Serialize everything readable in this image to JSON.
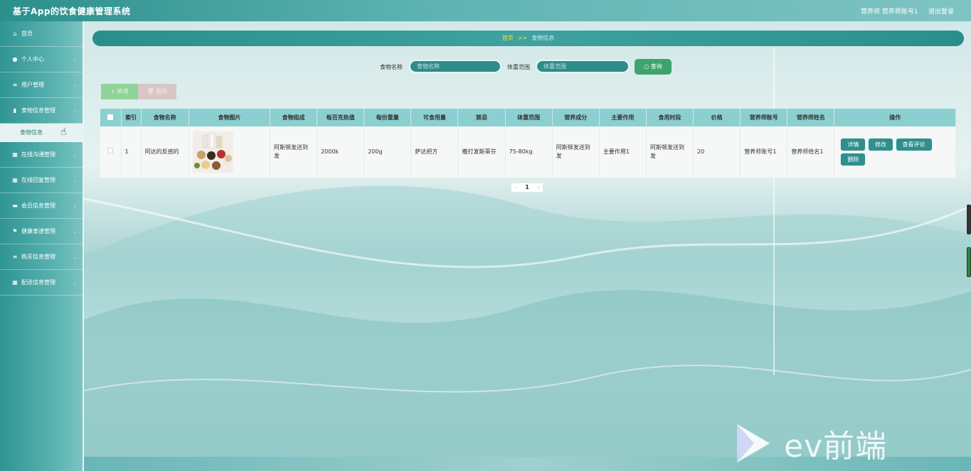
{
  "header": {
    "app_title": "基于App的饮食健康管理系统",
    "user_info": "营养师 营养师账号1",
    "logout": "退出登录"
  },
  "sidebar": {
    "items": [
      {
        "icon": "home-icon",
        "label": "首页"
      },
      {
        "icon": "user-icon",
        "label": "个人中心"
      },
      {
        "icon": "list-icon",
        "label": "用户管理"
      },
      {
        "icon": "book-icon",
        "label": "食物信息管理"
      },
      {
        "icon": "grid-icon",
        "label": "在线沟通管理"
      },
      {
        "icon": "grid-icon",
        "label": "在线回复管理"
      },
      {
        "icon": "card-icon",
        "label": "会员信息管理"
      },
      {
        "icon": "flag-icon",
        "label": "健康食谱管理"
      },
      {
        "icon": "list-icon",
        "label": "购买信息管理"
      },
      {
        "icon": "grid-icon",
        "label": "配送信息管理"
      }
    ],
    "active_sub": "食物信息"
  },
  "breadcrumb": {
    "home": "首页",
    "separator": ">>",
    "current": "食物信息"
  },
  "search": {
    "food_name_label": "食物名称",
    "food_name_placeholder": "食物名称",
    "weight_label": "体重范围",
    "weight_placeholder": "体重范围",
    "query_button": "查询"
  },
  "actions": {
    "add": "新增",
    "delete": "删除"
  },
  "table": {
    "columns": [
      "索引",
      "食物名称",
      "食物图片",
      "食物组成",
      "每百克热值",
      "每份重量",
      "可食用量",
      "禁忌",
      "体重范围",
      "营养成分",
      "主要作用",
      "食用时段",
      "价格",
      "营养师账号",
      "营养师姓名",
      "操作"
    ],
    "rows": [
      {
        "index": "1",
        "food_name": "阿达的反感的",
        "composition": "阿斯顿发送到发",
        "calories": "2000k",
        "portion_weight": "200g",
        "edible_amount": "萨达把方",
        "taboo": "撒打发斯蒂芬",
        "weight_range": "75-80kg",
        "nutrition": "阿斯顿发送到发",
        "main_effect": "主要作用1",
        "eating_time": "阿斯顿发送到发",
        "price": "20",
        "nutritionist_account": "营养师账号1",
        "nutritionist_name": "营养师姓名1",
        "ops": [
          "详情",
          "修改",
          "查看评论",
          "删除"
        ]
      }
    ]
  },
  "pagination": {
    "prev": "‹",
    "page": "1",
    "next": "›"
  },
  "watermark": {
    "text": "ev前端"
  },
  "colors": {
    "primary": "#2f8f8c",
    "query_button": "#3fa46b",
    "breadcrumb_home": "#f0e14a"
  }
}
